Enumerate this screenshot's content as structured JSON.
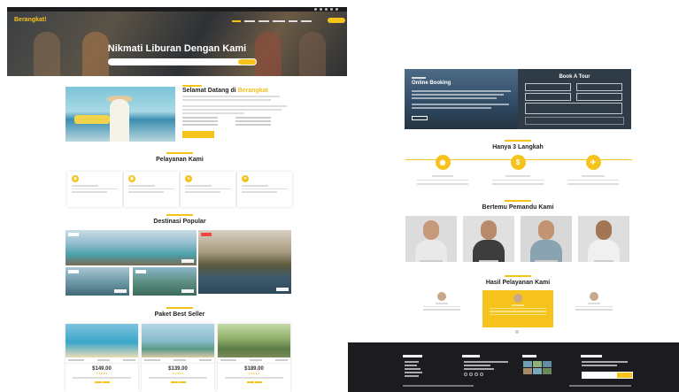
{
  "left": {
    "brand": "Berangkat!",
    "hero_title": "Nikmati Liburan Dengan Kami",
    "welcome": {
      "heading_prefix": "Selamat Datang di",
      "heading_brand": "Berangkat"
    },
    "services_title": "Pelayanan Kami",
    "destinations_title": "Destinasi Popular",
    "packages_title": "Paket Best Seller",
    "packages": [
      {
        "price": "$149.00"
      },
      {
        "price": "$139.00"
      },
      {
        "price": "$189.00"
      }
    ]
  },
  "right": {
    "booking_heading": "Online Booking",
    "book_tour_title": "Book A Tour",
    "steps_title": "Hanya 3 Langkah",
    "guides_title": "Bertemu Pemandu Kami",
    "testimonial_title": "Hasil Pelayanan Kami"
  },
  "colors": {
    "accent": "#f6c21c",
    "dark": "#1c1c20"
  }
}
